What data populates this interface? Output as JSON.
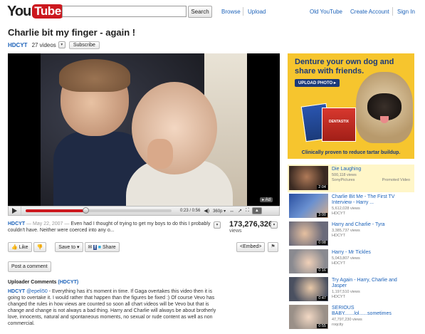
{
  "header": {
    "logo_you": "You",
    "logo_tube": "Tube",
    "search_placeholder": "",
    "search_button": "Search",
    "browse": "Browse",
    "upload": "Upload",
    "old_youtube": "Old YouTube",
    "create_account": "Create Account",
    "sign_in": "Sign In"
  },
  "video": {
    "title": "Charlie bit my finger - again !",
    "channel": "HDCYT",
    "video_count": "27 videos",
    "subscribe": "Subscribe",
    "ad_badge": "Ad",
    "time": "0:23 / 0:56",
    "quality": "360p",
    "progress_fraction": 0.41,
    "views_count": "173,276,326",
    "views_label": "views"
  },
  "description": {
    "author": "HDCYT",
    "date": "— May 22, 2007 —",
    "text": "Even had I thought of trying to get my boys to do this I probably couldn't have. Neither were coerced into any o..."
  },
  "actions": {
    "like": "Like",
    "save_to": "Save to",
    "share": "Share",
    "embed": "<Embed>",
    "post_comment": "Post a comment"
  },
  "uploader_comments": {
    "heading": "Uploader Comments",
    "channel": "(HDCYT)",
    "author": "HDCYT",
    "handle": "@epeli50",
    "text": "- Everything has it's moment in time. If Gaga overtakes this video then it is going to overtake it. I would rather that happen than the figures be fixed :) Of course Vevo has changed the rules in how views are counted so soon all chart videos will be Vevo but that is change and change is not always a bad thing. Harry and Charlie will always be about brotherly love, innocents, natural and spontaneous moments, no sexual or rude content as well as non commercial."
  },
  "ad": {
    "headline": "Denture your own dog and share with friends.",
    "upload_photo": "UPLOAD PHOTO",
    "box_label": "DENTASTIX",
    "footer": "Clinically proven to reduce tartar buildup."
  },
  "related": [
    {
      "title": "Die Laughing",
      "views": "500,118 views",
      "by": "SonyPictures",
      "duration": "2:04",
      "promoted": "Promoted Video"
    },
    {
      "title": "Charlie Bit Me - The First TV Interview - Harry ...",
      "views": "5,612,028 views",
      "by": "HDCYT",
      "duration": "3:00"
    },
    {
      "title": "Harry and Charlie - Tyra",
      "views": "3,385,737 views",
      "by": "HDCYT",
      "duration": "0:08"
    },
    {
      "title": "Harry - Mr Tickles",
      "views": "5,043,807 views",
      "by": "HDCYT",
      "duration": "0:16"
    },
    {
      "title": "Try Again - Harry, Charlie and Jasper",
      "views": "1,197,510 views",
      "by": "HDCYT",
      "duration": "0:47"
    },
    {
      "title": "SERIOUS BABY.......lol......sometimes",
      "views": "47,797,230 views",
      "by": "roqcity",
      "duration": "0:55"
    }
  ]
}
